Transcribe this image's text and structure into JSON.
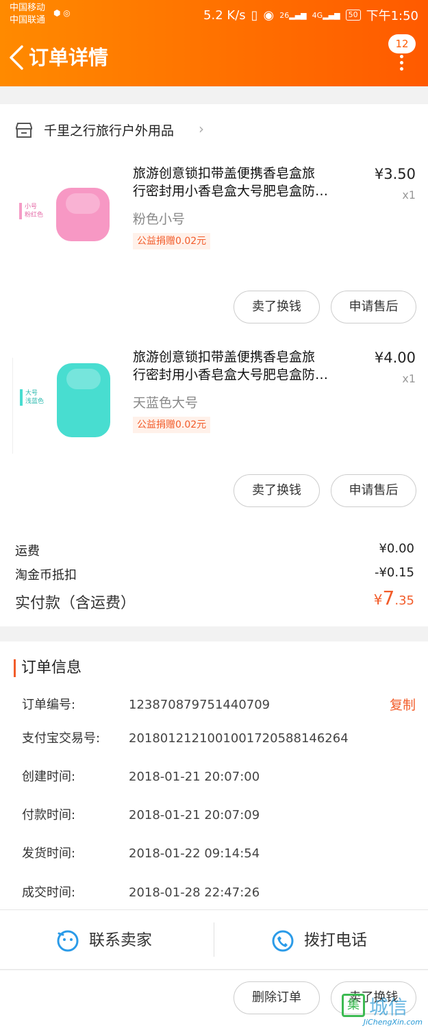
{
  "status_bar": {
    "carrier_1": "中国移动",
    "carrier_2": "中国联通",
    "speed": "5.2 K/s",
    "signal_1": "26",
    "signal_2": "4G",
    "battery": "50",
    "time": "下午1:50"
  },
  "nav": {
    "title": "订单详情",
    "badge": "12"
  },
  "shop": {
    "name": "千里之行旅行户外用品"
  },
  "items": [
    {
      "title_line1": "旅游创意锁扣带盖便携香皂盒旅",
      "title_line2": "行密封用小香皂盒大号肥皂盒防…",
      "price": "¥3.50",
      "qty": "x1",
      "sku": "粉色小号",
      "charity": "公益捐赠0.02元",
      "thumb_tag_1": "小号",
      "thumb_tag_2": "粉红色",
      "sell_btn": "卖了换钱",
      "after_sale_btn": "申请售后"
    },
    {
      "title_line1": "旅游创意锁扣带盖便携香皂盒旅",
      "title_line2": "行密封用小香皂盒大号肥皂盒防…",
      "price": "¥4.00",
      "qty": "x1",
      "sku": "天蓝色大号",
      "charity": "公益捐赠0.02元",
      "thumb_tag_1": "大号",
      "thumb_tag_2": "浅蓝色",
      "sell_btn": "卖了换钱",
      "after_sale_btn": "申请售后"
    }
  ],
  "fees": {
    "shipping_label": "运费",
    "shipping_value": "¥0.00",
    "coin_label": "淘金币抵扣",
    "coin_value": "-¥0.15",
    "total_label": "实付款（含运费）",
    "total_symbol": "¥",
    "total_int": "7",
    "total_dec": ".35"
  },
  "order_info": {
    "heading": "订单信息",
    "copy": "复制",
    "rows": [
      {
        "label": "订单编号:",
        "value": "123870879751440709"
      },
      {
        "label": "支付宝交易号:",
        "value": "2018012121001001720588146264"
      },
      {
        "label": "创建时间:",
        "value": "2018-01-21 20:07:00"
      },
      {
        "label": "付款时间:",
        "value": "2018-01-21 20:07:09"
      },
      {
        "label": "发货时间:",
        "value": "2018-01-22 09:14:54"
      },
      {
        "label": "成交时间:",
        "value": "2018-01-28 22:47:26"
      }
    ]
  },
  "contact": {
    "seller": "联系卖家",
    "phone": "拨打电话"
  },
  "bottom": {
    "delete": "删除订单",
    "sell": "卖了换钱"
  },
  "watermark": {
    "box": "集",
    "cn": "城信",
    "en": "JiChengXin.com"
  },
  "colors": {
    "accent": "#ff6a00",
    "price_orange": "#f25c2a",
    "soap_pink": "#f798c4",
    "soap_blue": "#48ddd0"
  }
}
